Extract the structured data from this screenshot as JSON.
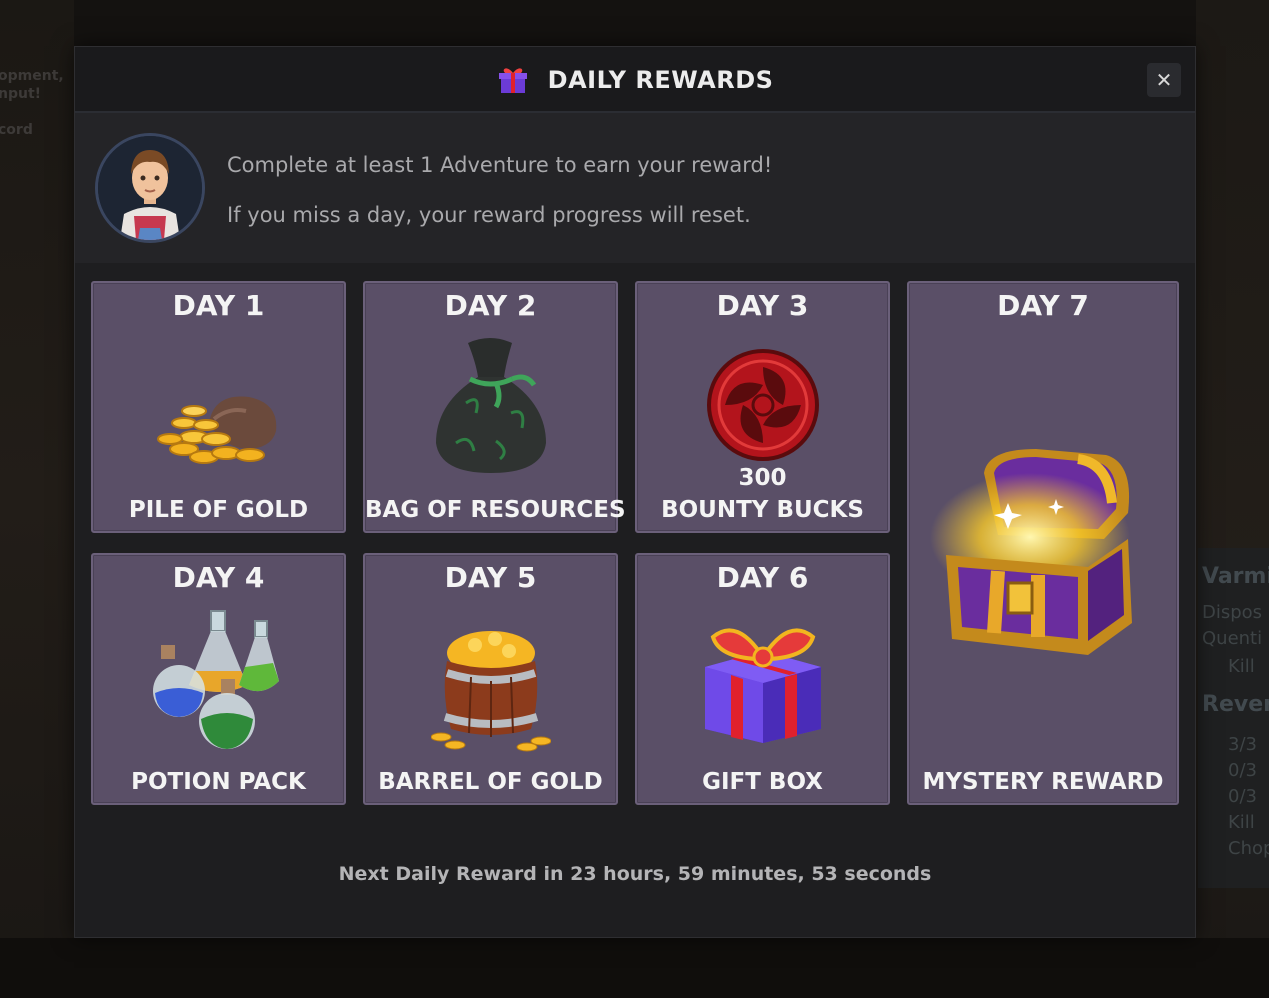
{
  "background": {
    "left_lines": [
      "opment,",
      "nput!",
      "cord"
    ],
    "right_lines": [
      "Varmi",
      "Dispos",
      "Quenti",
      "Kill",
      "Rever",
      "3/3",
      "0/3",
      "0/3",
      "Kill",
      "Chop"
    ]
  },
  "modal": {
    "title": "DAILY REWARDS",
    "close_label": "✕",
    "message_line1": "Complete at least 1 Adventure to earn your reward!",
    "message_line2": "If you miss a day, your reward progress will reset.",
    "footer": "Next Daily Reward in 23 hours, 59 minutes, 53 seconds"
  },
  "rewards": [
    {
      "day": "DAY 1",
      "label": "PILE OF GOLD",
      "icon": "gold-pile-icon"
    },
    {
      "day": "DAY 2",
      "label": "BAG OF RESOURCES",
      "icon": "resource-bag-icon"
    },
    {
      "day": "DAY 3",
      "amount": "300",
      "label": "BOUNTY BUCKS",
      "icon": "bounty-bucks-icon"
    },
    {
      "day": "DAY 4",
      "label": "POTION PACK",
      "icon": "potion-pack-icon"
    },
    {
      "day": "DAY 5",
      "label": "BARREL OF GOLD",
      "icon": "gold-barrel-icon"
    },
    {
      "day": "DAY 6",
      "label": "GIFT BOX",
      "icon": "gift-box-icon"
    },
    {
      "day": "DAY 7",
      "label": "MYSTERY REWARD",
      "icon": "treasure-chest-icon"
    }
  ],
  "colors": {
    "card_bg": "#5a4f67",
    "modal_bg": "#1e1e20",
    "gold": "#f3b21f",
    "bounty_red": "#b3141c"
  }
}
